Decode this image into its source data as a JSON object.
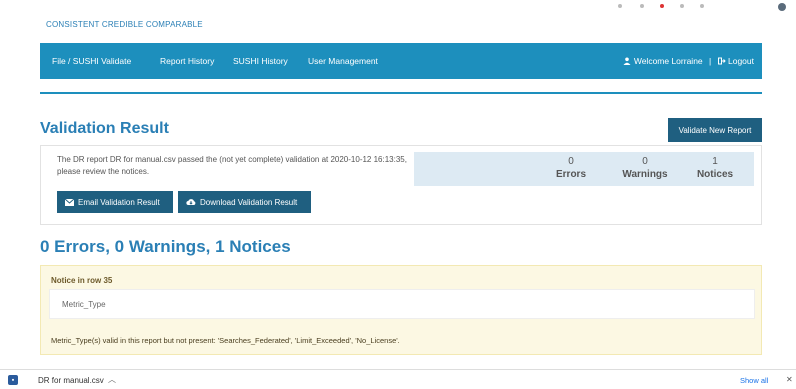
{
  "header": {
    "tagline": "CONSISTENT CREDIBLE COMPARABLE"
  },
  "nav": {
    "items": [
      "File / SUSHI Validate",
      "Report History",
      "SUSHI History",
      "User Management"
    ],
    "welcome": "Welcome Lorraine",
    "separator": "|",
    "logout": "Logout"
  },
  "validation": {
    "title": "Validation Result",
    "new_report_button": "Validate New Report",
    "message": "The DR report DR for manual.csv passed the (not yet complete) validation at 2020-10-12 16:13:35, please review the notices.",
    "counts": [
      {
        "value": "0",
        "label": "Errors"
      },
      {
        "value": "0",
        "label": "Warnings"
      },
      {
        "value": "1",
        "label": "Notices"
      }
    ],
    "email_button": "Email Validation Result",
    "download_button": "Download Validation Result"
  },
  "summary": "0 Errors, 0 Warnings, 1 Notices",
  "notice": {
    "title": "Notice in row 35",
    "field": "Metric_Type",
    "message": "Metric_Type(s) valid in this report but not present: 'Searches_Federated', 'Limit_Exceeded', 'No_License'."
  },
  "download_bar": {
    "file_name": "DR for manual.csv",
    "show_all": "Show all"
  },
  "colors": {
    "brand": "#1d8fbd",
    "button_dark": "#1f5f80",
    "heading": "#2a7fb5",
    "notice_bg": "#fcf8e3"
  }
}
